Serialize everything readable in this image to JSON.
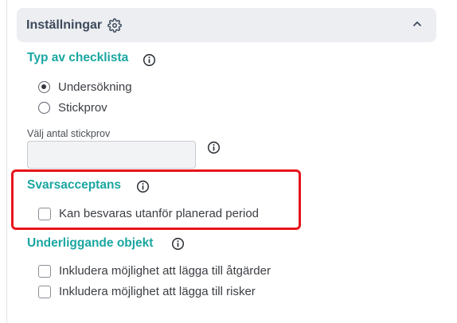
{
  "header": {
    "title": "Inställningar"
  },
  "checklist_type": {
    "title": "Typ av checklista",
    "options": [
      {
        "label": "Undersökning",
        "selected": true
      },
      {
        "label": "Stickprov",
        "selected": false
      }
    ],
    "sample_count_label": "Välj antal stickprov",
    "sample_count_value": ""
  },
  "response_acceptance": {
    "title": "Svarsacceptans",
    "option": {
      "label": "Kan besvaras utanför planerad period",
      "checked": false
    }
  },
  "underlying_objects": {
    "title": "Underliggande objekt",
    "options": [
      {
        "label": "Inkludera möjlighet att lägga till åtgärder",
        "checked": false
      },
      {
        "label": "Inkludera möjlighet att lägga till risker",
        "checked": false
      }
    ]
  },
  "colors": {
    "accent": "#1aa6a1",
    "highlight": "#e8141b",
    "header_bg": "#eceef1"
  }
}
